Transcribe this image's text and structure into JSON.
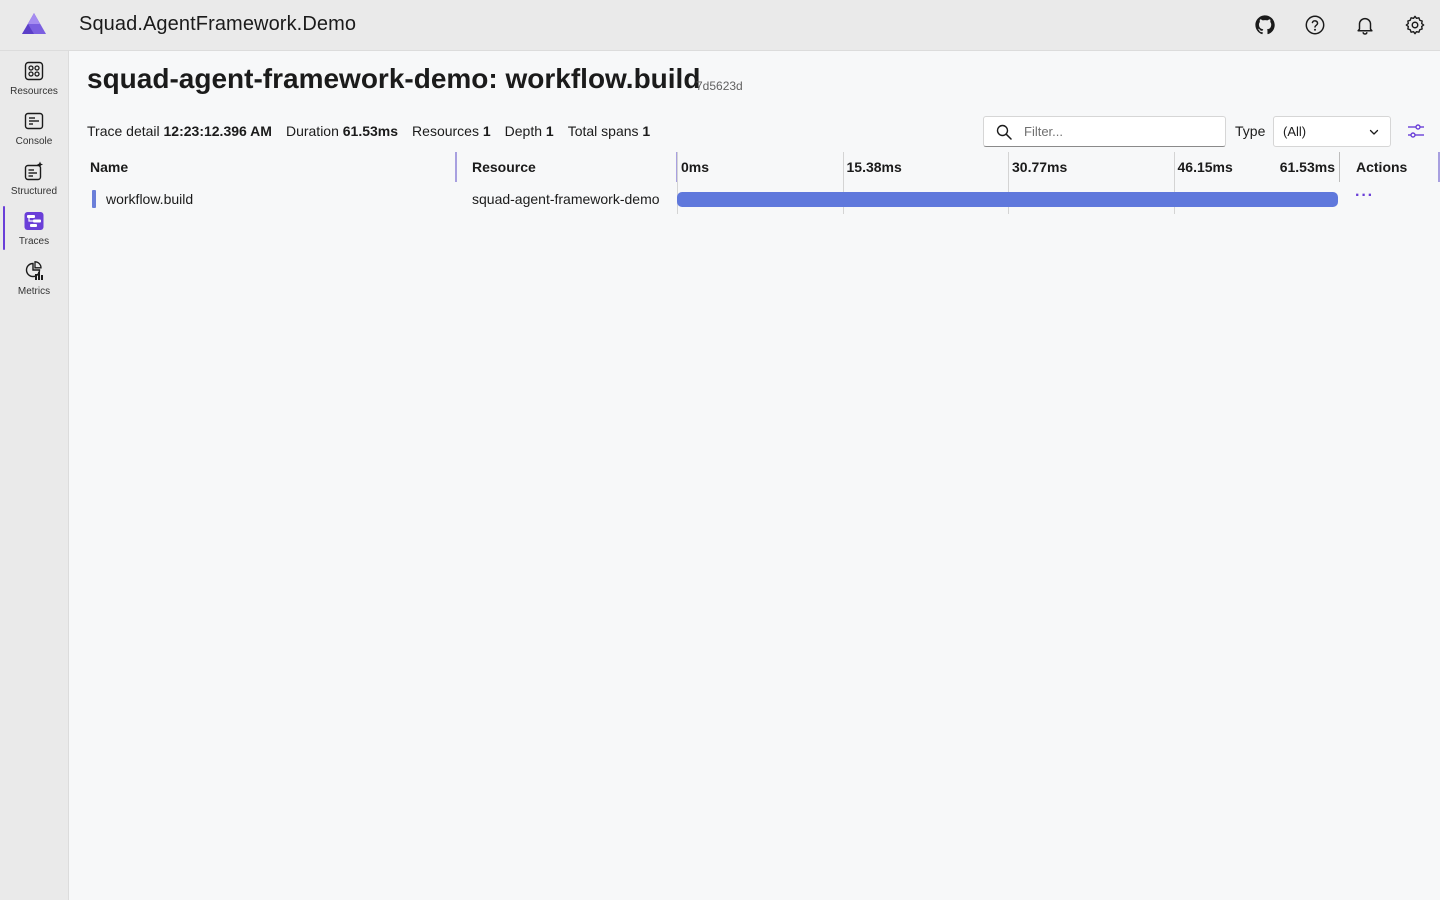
{
  "header": {
    "app_title": "Squad.AgentFramework.Demo",
    "icons": [
      "github-icon",
      "help-icon",
      "notifications-icon",
      "settings-icon"
    ],
    "accent_color": "#6a3fd8"
  },
  "sidebar": {
    "items": [
      {
        "label": "Resources",
        "icon": "resources-icon"
      },
      {
        "label": "Console",
        "icon": "console-icon"
      },
      {
        "label": "Structured",
        "icon": "structured-icon"
      },
      {
        "label": "Traces",
        "icon": "traces-icon",
        "active": true
      },
      {
        "label": "Metrics",
        "icon": "metrics-icon"
      }
    ]
  },
  "page": {
    "title": "squad-agent-framework-demo: workflow.build",
    "trace_id": "7d5623d"
  },
  "summary": {
    "trace_detail_label": "Trace detail",
    "trace_detail_value": "12:23:12.396 AM",
    "duration_label": "Duration",
    "duration_value": "61.53ms",
    "resources_label": "Resources",
    "resources_value": "1",
    "depth_label": "Depth",
    "depth_value": "1",
    "total_spans_label": "Total spans",
    "total_spans_value": "1"
  },
  "filter": {
    "placeholder": "Filter...",
    "value": ""
  },
  "type_filter": {
    "label": "Type",
    "selected": "(All)"
  },
  "grid": {
    "columns": {
      "name": "Name",
      "resource": "Resource",
      "actions": "Actions"
    },
    "ticks": [
      "0ms",
      "15.38ms",
      "30.77ms",
      "46.15ms",
      "61.53ms"
    ],
    "rows": [
      {
        "name": "workflow.build",
        "resource": "squad-agent-framework-demo",
        "span_start_fraction": 0,
        "span_end_fraction": 1,
        "actions": "···"
      }
    ],
    "span_color": "#5f78dc"
  }
}
